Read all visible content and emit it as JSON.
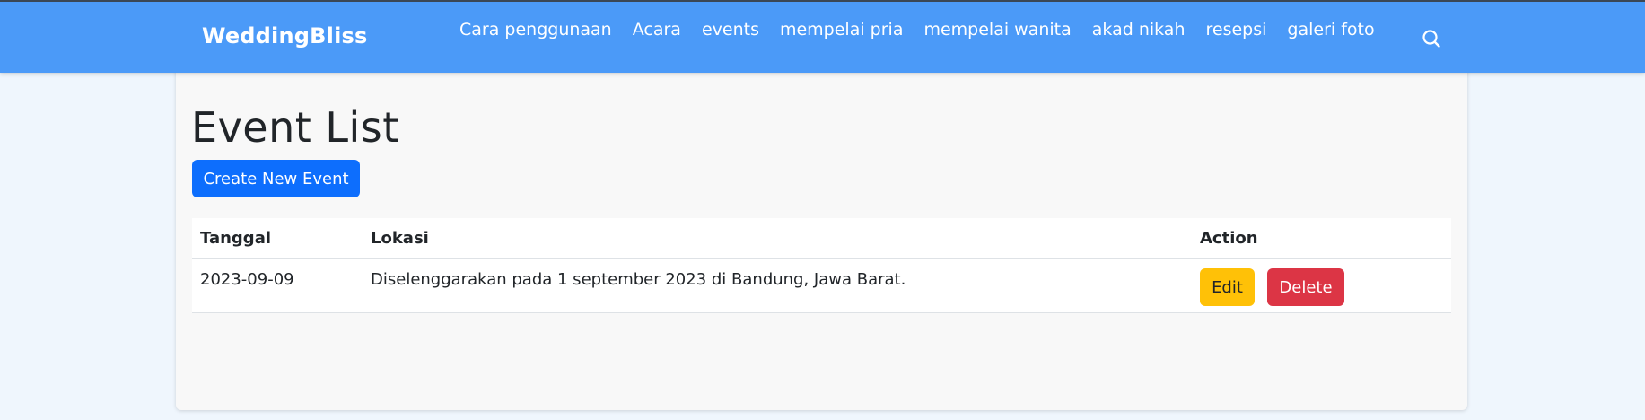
{
  "navbar": {
    "brand": "WeddingBliss",
    "links": [
      "Cara penggunaan",
      "Acara",
      "events",
      "mempelai pria",
      "mempelai wanita",
      "akad nikah",
      "resepsi",
      "galeri foto"
    ],
    "search_icon": "search-icon",
    "bg_color": "#4b9af8"
  },
  "main": {
    "title": "Event List",
    "create_button": "Create New Event",
    "table": {
      "headers": [
        "Tanggal",
        "Lokasi",
        "Action"
      ],
      "rows": [
        {
          "tanggal": "2023-09-09",
          "lokasi": "Diselenggarakan pada 1 september 2023 di Bandung, Jawa Barat.",
          "edit_label": "Edit",
          "delete_label": "Delete"
        }
      ]
    }
  },
  "colors": {
    "primary": "#0d6efd",
    "warning": "#ffc107",
    "danger": "#dc3545"
  }
}
